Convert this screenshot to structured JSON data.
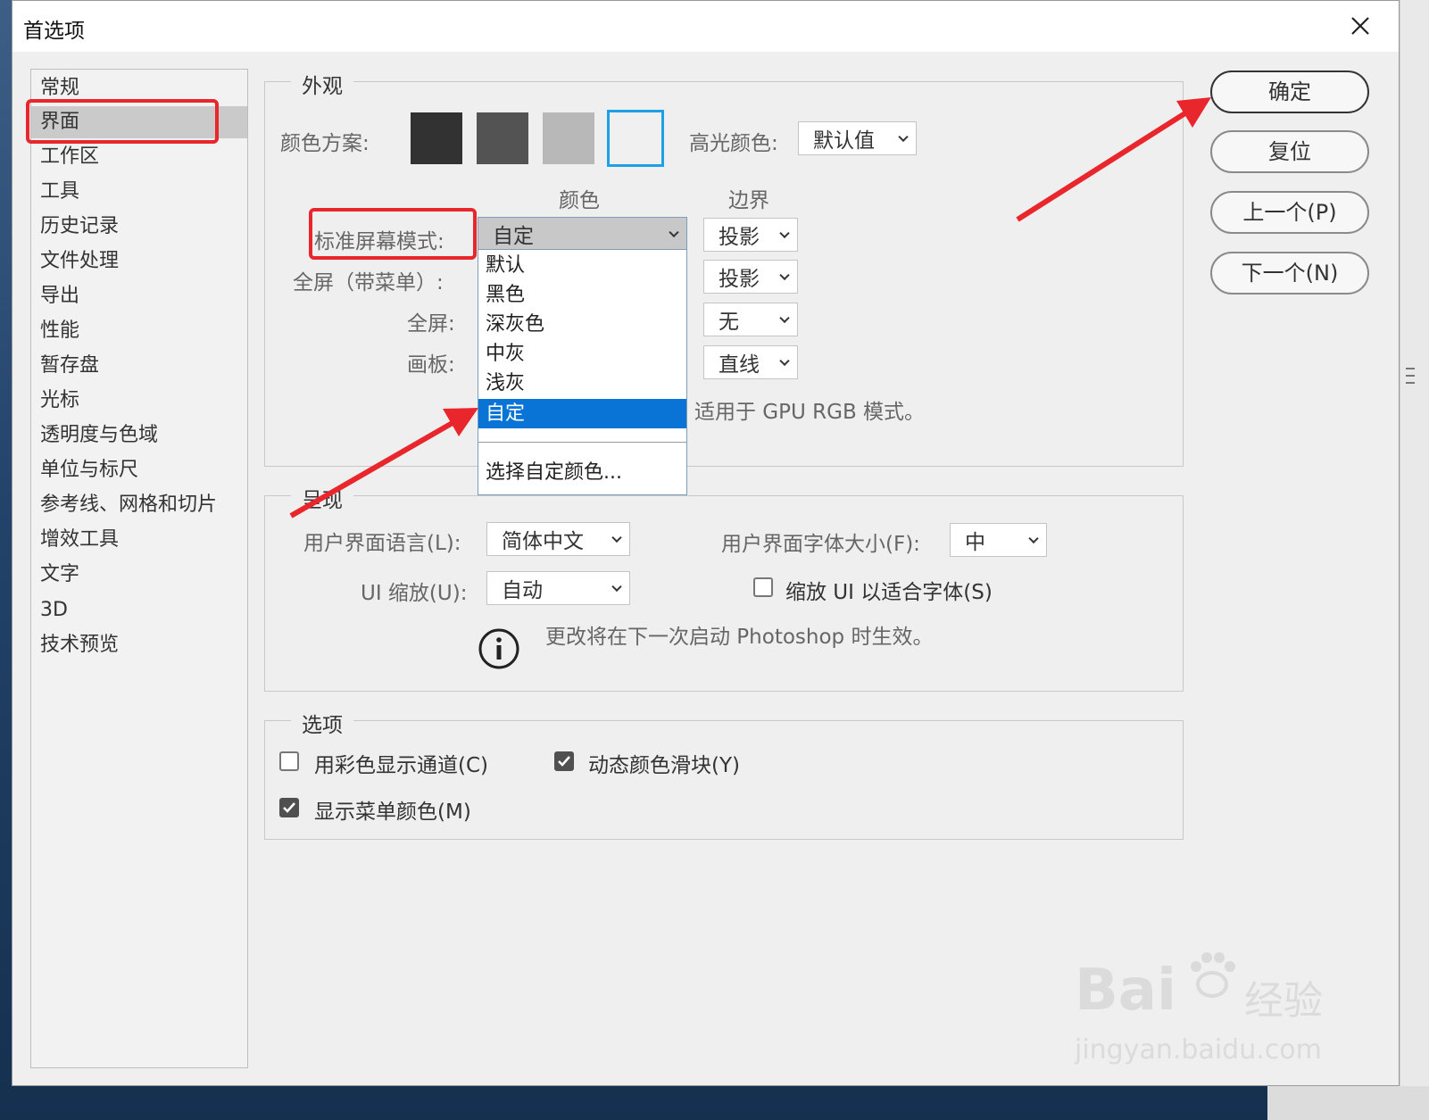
{
  "dialog": {
    "title": "首选项",
    "close_icon": "close-icon"
  },
  "nav": {
    "items": [
      {
        "label": "常规",
        "selected": false
      },
      {
        "label": "界面",
        "selected": true
      },
      {
        "label": "工作区",
        "selected": false
      },
      {
        "label": "工具",
        "selected": false
      },
      {
        "label": "历史记录",
        "selected": false
      },
      {
        "label": "文件处理",
        "selected": false
      },
      {
        "label": "导出",
        "selected": false
      },
      {
        "label": "性能",
        "selected": false
      },
      {
        "label": "暂存盘",
        "selected": false
      },
      {
        "label": "光标",
        "selected": false
      },
      {
        "label": "透明度与色域",
        "selected": false
      },
      {
        "label": "单位与标尺",
        "selected": false
      },
      {
        "label": "参考线、网格和切片",
        "selected": false
      },
      {
        "label": "增效工具",
        "selected": false
      },
      {
        "label": "文字",
        "selected": false
      },
      {
        "label": "3D",
        "selected": false
      },
      {
        "label": "技术预览",
        "selected": false
      }
    ]
  },
  "appearance": {
    "group_label": "外观",
    "color_scheme_label": "颜色方案:",
    "swatches": [
      "#323232",
      "#535353",
      "#b8b8b8",
      "#f0f0f0"
    ],
    "selected_swatch_border": "#1ea0e6",
    "highlight_label": "高光颜色:",
    "highlight_value": "默认值",
    "col_color": "颜色",
    "col_border": "边界",
    "rows": [
      {
        "label": "标准屏幕模式:",
        "color": "自定",
        "border": "投影"
      },
      {
        "label": "全屏（带菜单）:",
        "border": "投影"
      },
      {
        "label": "全屏:",
        "border": "无"
      },
      {
        "label": "画板:",
        "border": "直线"
      }
    ],
    "note": "适用于 GPU RGB 模式。"
  },
  "color_dropdown": {
    "items": [
      "默认",
      "黑色",
      "深灰色",
      "中灰",
      "浅灰",
      "自定"
    ],
    "highlighted": "自定",
    "custom_item": "选择自定颜色...",
    "highlight_color": "#0a74d6"
  },
  "presentation": {
    "group_label": "呈现",
    "ui_language_label": "用户界面语言(L):",
    "ui_language_value": "简体中文",
    "ui_font_size_label": "用户界面字体大小(F):",
    "ui_font_size_value": "中",
    "ui_scale_label": "UI 缩放(U):",
    "ui_scale_value": "自动",
    "scale_to_font_label": "缩放 UI 以适合字体(S)",
    "scale_to_font_checked": false,
    "info_icon": "info-icon",
    "info_text": "更改将在下一次启动 Photoshop 时生效。"
  },
  "options": {
    "group_label": "选项",
    "show_channels_color_label": "用彩色显示通道(C)",
    "show_channels_color_checked": false,
    "dynamic_sliders_label": "动态颜色滑块(Y)",
    "dynamic_sliders_checked": true,
    "show_menu_colors_label": "显示菜单颜色(M)",
    "show_menu_colors_checked": true
  },
  "buttons": {
    "ok": "确定",
    "reset": "复位",
    "prev": "上一个(P)",
    "next": "下一个(N)"
  },
  "watermark": {
    "brand": "Bai",
    "brand_suffix": "经验",
    "url": "jingyan.baidu.com"
  },
  "annotation_color": "#e8262b"
}
